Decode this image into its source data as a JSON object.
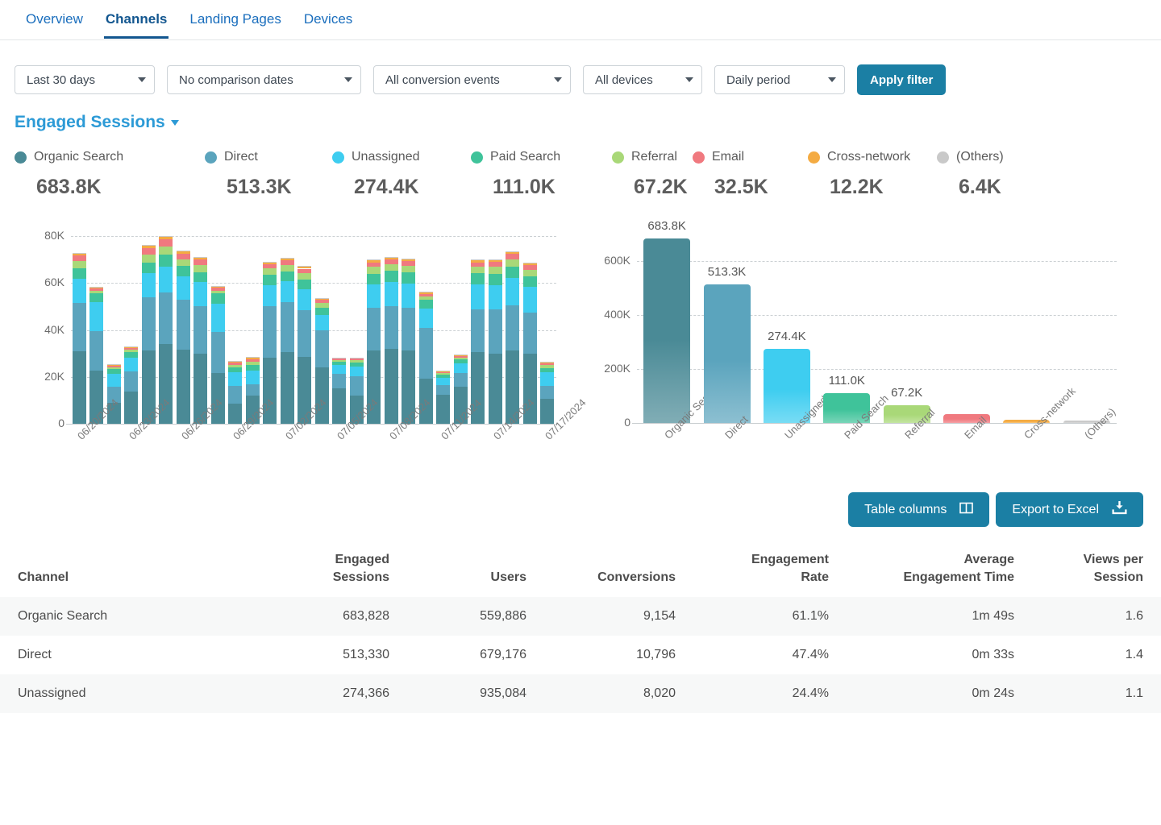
{
  "tabs": [
    {
      "label": "Overview",
      "active": false
    },
    {
      "label": "Channels",
      "active": true
    },
    {
      "label": "Landing Pages",
      "active": false
    },
    {
      "label": "Devices",
      "active": false
    }
  ],
  "filters": {
    "date_range": "Last 30 days",
    "comparison": "No comparison dates",
    "conversion_events": "All conversion events",
    "devices": "All devices",
    "period": "Daily period",
    "apply_label": "Apply filter"
  },
  "metric_selector": {
    "label": "Engaged Sessions"
  },
  "legend": [
    {
      "name": "Organic Search",
      "value": "683.8K",
      "color": "#4a8a96"
    },
    {
      "name": "Direct",
      "value": "513.3K",
      "color": "#5ba4bd"
    },
    {
      "name": "Unassigned",
      "value": "274.4K",
      "color": "#3ecdf0"
    },
    {
      "name": "Paid Search",
      "value": "111.0K",
      "color": "#3fc39a"
    },
    {
      "name": "Referral",
      "value": "67.2K",
      "color": "#a9d878"
    },
    {
      "name": "Email",
      "value": "32.5K",
      "color": "#f0797f"
    },
    {
      "name": "Cross-network",
      "value": "12.2K",
      "color": "#f4ab42"
    },
    {
      "name": "(Others)",
      "value": "6.4K",
      "color": "#c9c9c9"
    }
  ],
  "actions": {
    "table_columns": "Table columns",
    "export_excel": "Export to Excel"
  },
  "table": {
    "headers": [
      "Channel",
      "Engaged\nSessions",
      "Users",
      "Conversions",
      "Engagement\nRate",
      "Average\nEngagement Time",
      "Views per\nSession"
    ],
    "rows": [
      [
        "Organic Search",
        "683,828",
        "559,886",
        "9,154",
        "61.1%",
        "1m 49s",
        "1.6"
      ],
      [
        "Direct",
        "513,330",
        "679,176",
        "10,796",
        "47.4%",
        "0m 33s",
        "1.4"
      ],
      [
        "Unassigned",
        "274,366",
        "935,084",
        "8,020",
        "24.4%",
        "0m 24s",
        "1.1"
      ]
    ]
  },
  "chart_data": [
    {
      "type": "bar",
      "id": "stacked-daily",
      "stacked": true,
      "title": "",
      "xlabel": "",
      "ylabel": "",
      "ylim": [
        0,
        80000
      ],
      "yticks": [
        0,
        20000,
        40000,
        60000,
        80000
      ],
      "ytick_labels": [
        "0",
        "20K",
        "40K",
        "60K",
        "80K"
      ],
      "grid": true,
      "x": [
        "06/20/2024",
        "06/21/2024",
        "06/22/2024",
        "06/23/2024",
        "06/24/2024",
        "06/25/2024",
        "06/26/2024",
        "06/27/2024",
        "06/28/2024",
        "06/29/2024",
        "06/30/2024",
        "07/01/2024",
        "07/02/2024",
        "07/03/2024",
        "07/04/2024",
        "07/05/2024",
        "07/06/2024",
        "07/07/2024",
        "07/08/2024",
        "07/09/2024",
        "07/10/2024",
        "07/11/2024",
        "07/12/2024",
        "07/13/2024",
        "07/14/2024",
        "07/15/2024",
        "07/16/2024",
        "07/17/2024"
      ],
      "xtick_labels": [
        "06/20/2024",
        "06/23/2024",
        "06/26/2024",
        "06/29/2024",
        "07/02/2024",
        "07/05/2024",
        "07/08/2024",
        "07/11/2024",
        "07/14/2024",
        "07/17/2024"
      ],
      "xtick_indices": [
        0,
        3,
        6,
        9,
        12,
        15,
        18,
        21,
        24,
        27
      ],
      "series": [
        {
          "name": "Organic Search",
          "color": "#4a8a96",
          "values": [
            30800,
            22700,
            8900,
            13600,
            31200,
            33900,
            31500,
            29800,
            21500,
            8500,
            12100,
            28200,
            30600,
            28400,
            24100,
            15200,
            12000,
            31300,
            31900,
            31300,
            19100,
            12300,
            15900,
            30400,
            30000,
            31200,
            29900,
            10700
          ]
        },
        {
          "name": "Direct",
          "color": "#5ba4bd",
          "values": [
            20800,
            16800,
            6900,
            8600,
            22700,
            22200,
            21300,
            20300,
            17700,
            7700,
            4600,
            22000,
            21100,
            20000,
            15700,
            6200,
            8100,
            18100,
            18400,
            18100,
            21800,
            4300,
            5900,
            18300,
            18600,
            19300,
            17500,
            5300
          ]
        },
        {
          "name": "Unassigned",
          "color": "#3ecdf0",
          "values": [
            10200,
            12400,
            5500,
            5900,
            10200,
            10900,
            10100,
            10200,
            12100,
            5700,
            6100,
            9000,
            9000,
            9000,
            6400,
            3600,
            4300,
            10000,
            10100,
            10200,
            8200,
            3000,
            4000,
            10700,
            10600,
            11600,
            10900,
            5900
          ]
        },
        {
          "name": "Paid Search",
          "color": "#3fc39a",
          "values": [
            4600,
            3700,
            1900,
            2400,
            4600,
            5200,
            4400,
            4400,
            4200,
            2100,
            2400,
            4200,
            4300,
            4200,
            3300,
            1500,
            1700,
            4600,
            4700,
            4800,
            3900,
            1300,
            1600,
            4700,
            4800,
            5000,
            4600,
            1900
          ]
        },
        {
          "name": "Referral",
          "color": "#a9d878",
          "values": [
            2900,
            1100,
            800,
            1000,
            3500,
            3200,
            2800,
            2900,
            1300,
            1200,
            1400,
            2800,
            2800,
            2700,
            2000,
            700,
            900,
            2800,
            2900,
            2800,
            1300,
            600,
            800,
            2800,
            2900,
            3000,
            2800,
            1100
          ]
        },
        {
          "name": "Email",
          "color": "#f0797f",
          "values": [
            2500,
            900,
            600,
            700,
            2700,
            3200,
            2500,
            2500,
            1100,
            900,
            1000,
            1800,
            1900,
            1800,
            1400,
            600,
            700,
            2000,
            2100,
            2000,
            1100,
            500,
            600,
            1900,
            2000,
            2200,
            1900,
            800
          ]
        },
        {
          "name": "Cross-network",
          "color": "#f4ab42",
          "values": [
            800,
            700,
            500,
            600,
            900,
            1000,
            800,
            800,
            700,
            500,
            600,
            800,
            800,
            800,
            600,
            400,
            400,
            800,
            800,
            800,
            600,
            400,
            500,
            800,
            800,
            900,
            800,
            500
          ]
        },
        {
          "name": "(Others)",
          "color": "#c9c9c9",
          "values": [
            300,
            200,
            200,
            200,
            300,
            300,
            300,
            300,
            200,
            200,
            200,
            300,
            300,
            300,
            200,
            100,
            200,
            300,
            300,
            300,
            200,
            100,
            200,
            300,
            300,
            300,
            300,
            200
          ]
        }
      ]
    },
    {
      "type": "bar",
      "id": "channel-totals",
      "stacked": false,
      "title": "",
      "xlabel": "",
      "ylabel": "",
      "ylim": [
        0,
        700000
      ],
      "yticks": [
        0,
        200000,
        400000,
        600000
      ],
      "ytick_labels": [
        "0",
        "200K",
        "400K",
        "600K"
      ],
      "grid": true,
      "categories": [
        "Organic Search",
        "Direct",
        "Unassigned",
        "Paid Search",
        "Referral",
        "Email",
        "Cross-network",
        "(Others)"
      ],
      "values": [
        683828,
        513330,
        274366,
        111000,
        67200,
        32500,
        12200,
        6400
      ],
      "data_labels": [
        "683.8K",
        "513.3K",
        "274.4K",
        "111.0K",
        "67.2K",
        "",
        "",
        ""
      ],
      "colors": [
        "#4a8a96",
        "#5ba4bd",
        "#3ecdf0",
        "#3fc39a",
        "#a9d878",
        "#f0797f",
        "#f4ab42",
        "#c9c9c9"
      ]
    }
  ]
}
